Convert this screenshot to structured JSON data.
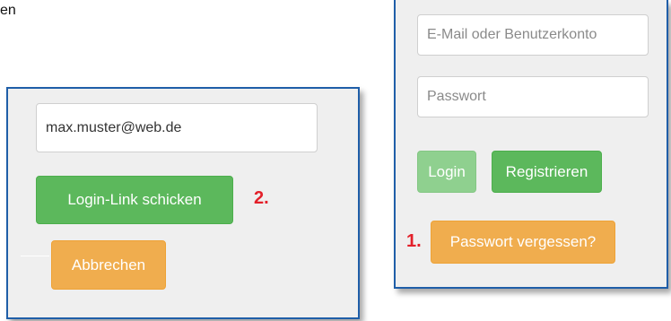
{
  "stray_text": "en",
  "reset_panel": {
    "email_value": "max.muster@web.de",
    "send_button": "Login-Link schicken",
    "cancel_button": "Abbrechen",
    "step_label": "2."
  },
  "login_panel": {
    "email_placeholder": "E-Mail oder Benutzerkonto",
    "password_placeholder": "Passwort",
    "login_button": "Login",
    "register_button": "Registrieren",
    "forgot_button": "Passwort vergessen?",
    "step_label": "1."
  },
  "colors": {
    "panel_border": "#1f5ea8",
    "green": "#5cb85c",
    "orange": "#f0ad4e",
    "step_red": "#e3202a"
  }
}
